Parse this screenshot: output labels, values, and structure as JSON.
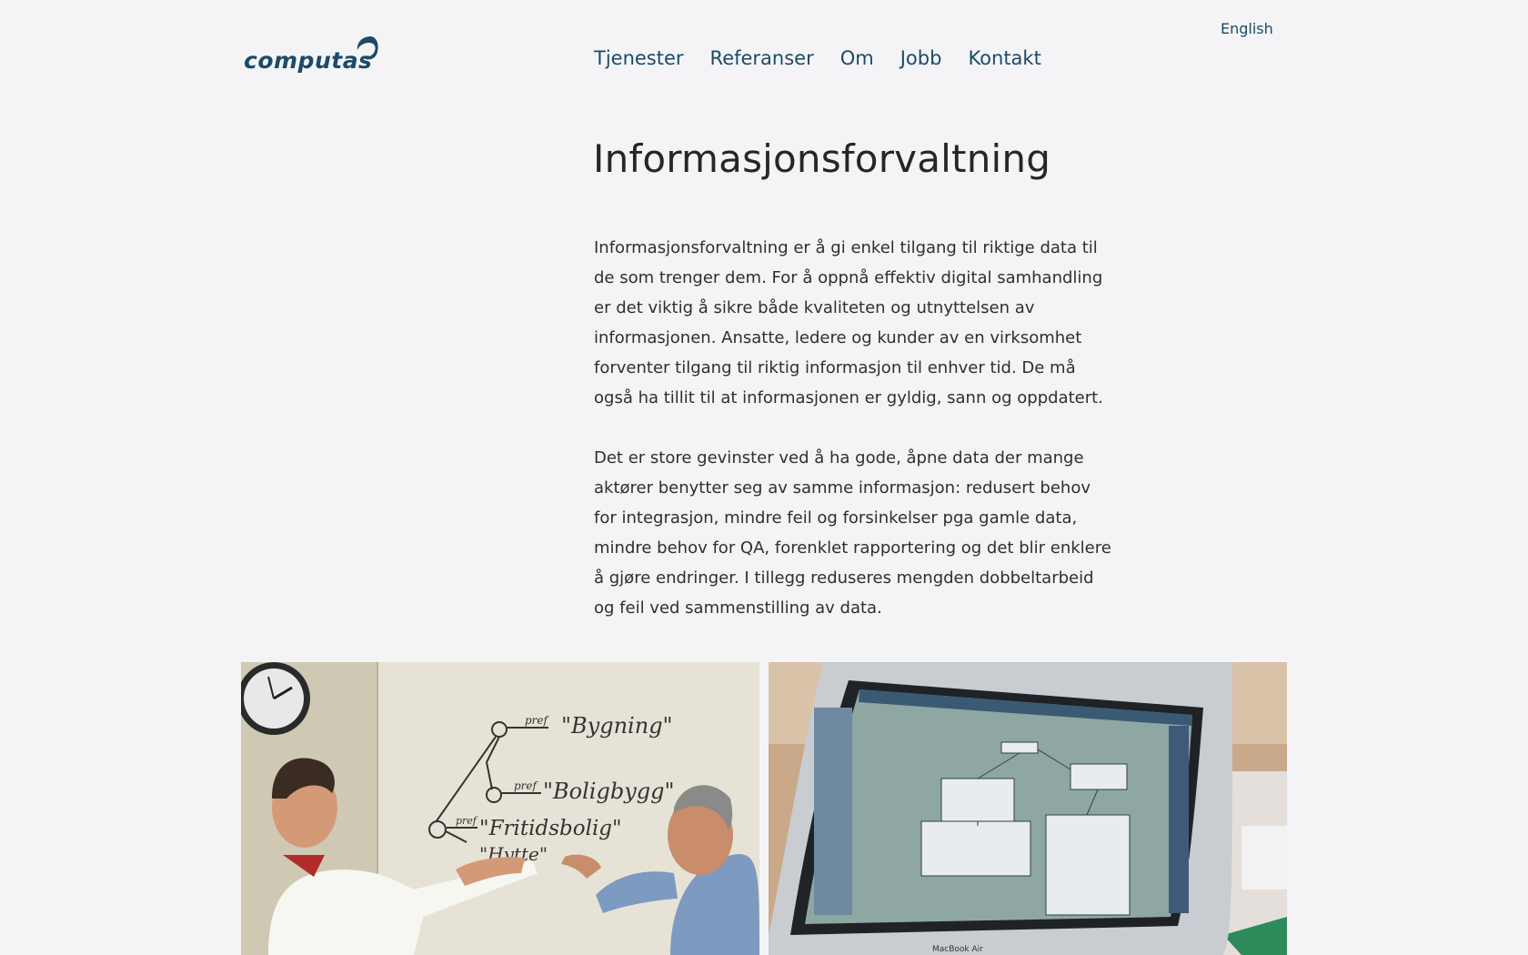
{
  "header": {
    "language_link": "English",
    "logo_text": "computas"
  },
  "nav": {
    "items": [
      {
        "label": "Tjenester"
      },
      {
        "label": "Referanser"
      },
      {
        "label": "Om"
      },
      {
        "label": "Jobb"
      },
      {
        "label": "Kontakt"
      }
    ]
  },
  "main": {
    "title": "Informasjonsforvaltning",
    "paragraphs": [
      "Informasjonsforvaltning er å gi enkel tilgang til riktige data til de som trenger dem. For å oppnå effektiv digital samhandling er det viktig å sikre både kvaliteten og utnyttelsen av informasjonen. Ansatte, ledere og kunder av en virksomhet forventer tilgang til riktig informasjon til enhver tid. De må også ha tillit til at informasjonen er gyldig, sann og oppdatert.",
      "Det er store gevinster ved å ha gode, åpne data der mange aktører benytter seg av samme informasjon: redusert behov for integrasjon, mindre feil og forsinkelser pga gamle data, mindre behov for QA, forenklet rapportering og det blir enklere å gjøre endringer. I tillegg reduseres mengden dobbeltarbeid og feil ved sammenstilling av data."
    ]
  },
  "photos": {
    "whiteboard": {
      "line1": "\"Bygning\"",
      "line2": "\"Boligbygg\"",
      "line3": "\"Fritidsbolig\"",
      "line4": "\"Hytte\"",
      "pref": "pref",
      "laptop_label": "MacBook Air"
    }
  },
  "colors": {
    "background": "#f4f4f6",
    "brand": "#1d4a67",
    "text": "#2b2b2b"
  }
}
